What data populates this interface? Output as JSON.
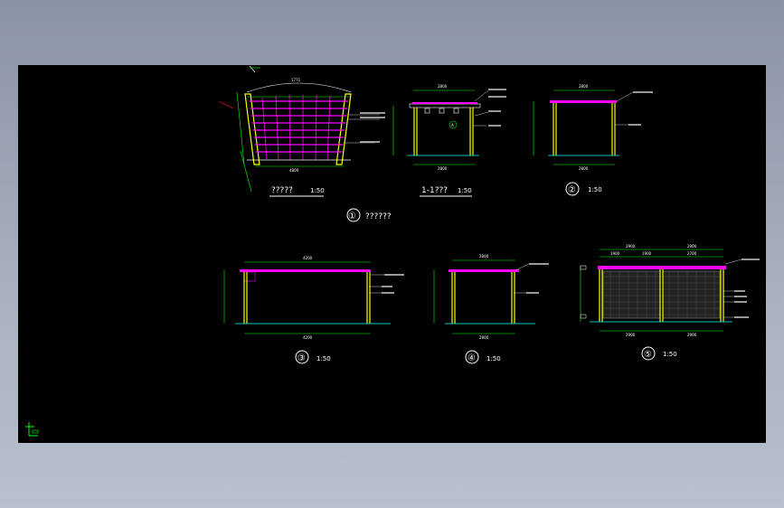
{
  "drawing": {
    "plan": {
      "title": "?????",
      "scale": "1:50",
      "top_dim": "1771",
      "width_dim": "4800"
    },
    "section": {
      "title": "1-1???",
      "scale": "1:50",
      "top_dim": "2800",
      "bottom_dim": "2800",
      "callout": "A"
    },
    "elev2": {
      "number": "②",
      "scale": "1:50",
      "top_dim": "2800",
      "bottom_dim": "2800"
    },
    "group_label": {
      "number": "①",
      "text": "??????"
    },
    "elev3": {
      "number": "③",
      "scale": "1:50",
      "top_dim": "4200",
      "bottom_dim": "4200"
    },
    "elev4": {
      "number": "④",
      "scale": "1:50",
      "top_dim": "2800",
      "bottom_dim": "2800"
    },
    "elev5": {
      "number": "⑤",
      "scale": "1:50",
      "top_dims": [
        "2900",
        "2900"
      ],
      "sub_dims": [
        "1900",
        "1900",
        "2700"
      ],
      "bottom_dims": [
        "2900",
        "2900"
      ]
    }
  }
}
